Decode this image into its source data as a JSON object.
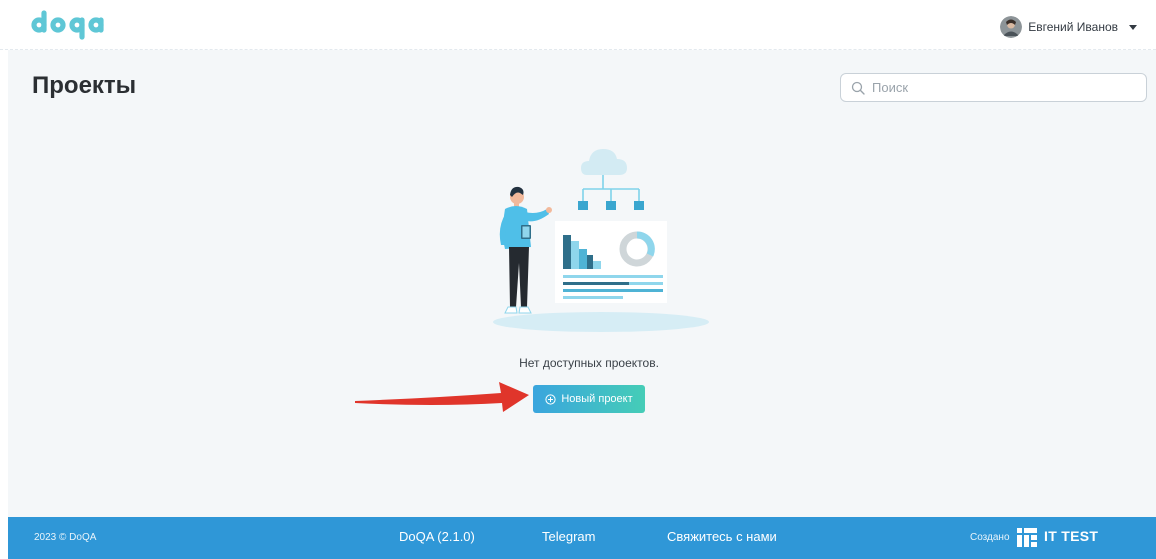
{
  "header": {
    "logo_icon": "doqa-logo",
    "user": {
      "name": "Евгений Иванов",
      "avatar_icon": "user-avatar",
      "dropdown_icon": "caret-down-icon"
    }
  },
  "page": {
    "title": "Проекты",
    "search": {
      "placeholder": "Поиск",
      "value": "",
      "icon": "search-icon"
    },
    "empty_state": {
      "illustration_icon": "empty-projects-illustration",
      "message": "Нет доступных проектов.",
      "button_label": "Новый проект",
      "button_icon": "plus-circle-icon"
    },
    "annotation_icon": "red-arrow-icon"
  },
  "footer": {
    "copyright": "2023 © DoQA",
    "version": "DoQA (2.1.0)",
    "telegram": "Telegram",
    "contact": "Свяжитесь с нами",
    "created_by": "Создано",
    "company": "IT TEST",
    "company_logo_icon": "ittest-logo"
  },
  "colors": {
    "accent": "#2f97d7",
    "button_gradient_start": "#3aa5de",
    "button_gradient_end": "#45cdb7",
    "logo": "#5fc7d6",
    "background": "#f4f7f9",
    "arrow": "#e0352b"
  }
}
